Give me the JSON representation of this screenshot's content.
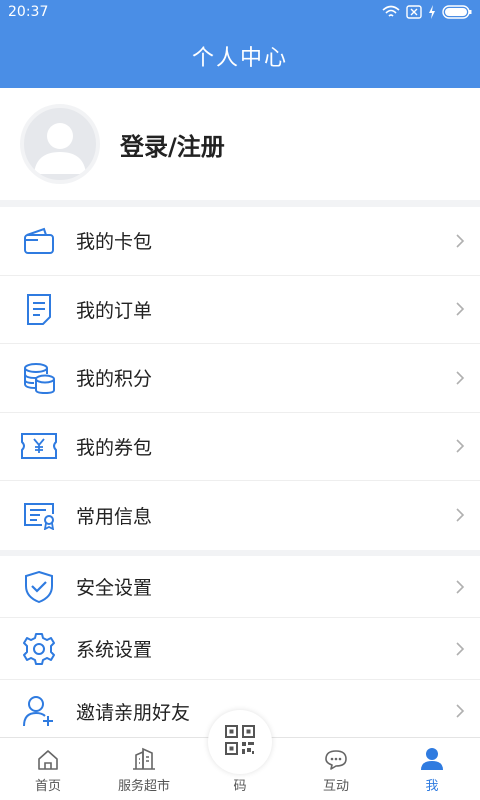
{
  "status": {
    "time": "20:37"
  },
  "header": {
    "title": "个人中心"
  },
  "profile": {
    "login_label": "登录/注册"
  },
  "menu_group_1": [
    {
      "label": "我的卡包",
      "icon": "wallet-icon"
    },
    {
      "label": "我的订单",
      "icon": "order-icon"
    },
    {
      "label": "我的积分",
      "icon": "coins-icon"
    },
    {
      "label": "我的券包",
      "icon": "coupon-icon"
    },
    {
      "label": "常用信息",
      "icon": "info-card-icon"
    }
  ],
  "menu_group_2": [
    {
      "label": "安全设置",
      "icon": "shield-icon"
    },
    {
      "label": "系统设置",
      "icon": "gear-icon"
    },
    {
      "label": "邀请亲朋好友",
      "icon": "invite-user-icon"
    }
  ],
  "tabbar": {
    "items": [
      {
        "label": "首页",
        "icon": "home-icon"
      },
      {
        "label": "服务超市",
        "icon": "buildings-icon"
      },
      {
        "label": "码",
        "icon": "qr-code-icon"
      },
      {
        "label": "互动",
        "icon": "chat-icon"
      },
      {
        "label": "我",
        "icon": "user-icon",
        "active": true
      }
    ]
  },
  "colors": {
    "primary": "#4a8ee6",
    "icon_blue": "#2f7be0",
    "background": "#f2f3f5"
  }
}
